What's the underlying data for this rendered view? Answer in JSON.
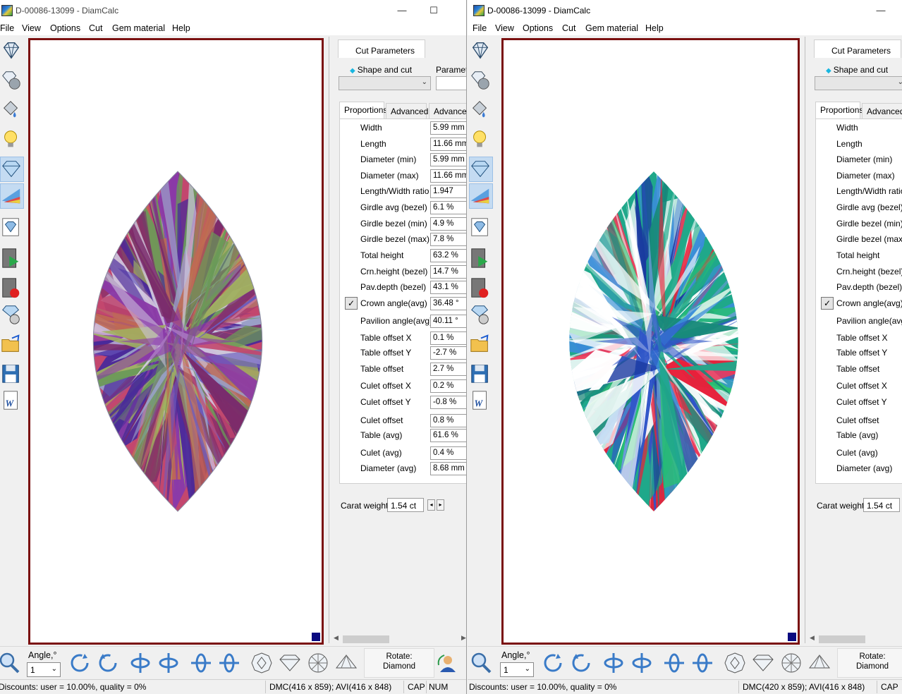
{
  "windows": [
    {
      "title": "D-00086-13099 - DiamCalc",
      "menu": [
        "File",
        "View",
        "Options",
        "Cut",
        "Gem material",
        "Help"
      ],
      "panel_tab": "Cut Parameters",
      "shape_label": "Shape and cut",
      "param_label": "Paramete",
      "inner_tabs": [
        "Proportions",
        "Advanced",
        "Advanced"
      ],
      "params": [
        {
          "label": "Width",
          "value": "5.99 mm"
        },
        {
          "label": "Length",
          "value": "11.66 mm"
        },
        {
          "label": "Diameter (min)",
          "value": "5.99 mm"
        },
        {
          "label": "Diameter (max)",
          "value": "11.66 mm"
        },
        {
          "label": "Length/Width ratio",
          "value": "1.947"
        },
        {
          "label": "Girdle avg (bezel)",
          "value": "6.1 %"
        },
        {
          "label": "Girdle bezel (min)",
          "value": "4.9 %"
        },
        {
          "label": "Girdle bezel (max)",
          "value": "7.8 %"
        },
        {
          "label": "Total height",
          "value": "63.2 %"
        },
        {
          "label": "Crn.height (bezel)",
          "value": "14.7 %"
        },
        {
          "label": "Pav.depth (bezel)",
          "value": "43.1 %"
        },
        {
          "label": "Crown angle(avg)",
          "value": "36.48 °"
        },
        {
          "label": "Pavilion angle(avg)",
          "value": "40.11 °"
        },
        {
          "label": "Table offset X",
          "value": "0.1 %"
        },
        {
          "label": "Table offset Y",
          "value": "-2.7 %"
        },
        {
          "label": "Table offset",
          "value": "2.7 %"
        },
        {
          "label": "Culet offset X",
          "value": "0.2 %"
        },
        {
          "label": "Culet offset Y",
          "value": "-0.8 %"
        },
        {
          "label": "Culet offset",
          "value": "0.8 %"
        },
        {
          "label": "Table (avg)",
          "value": "61.6 %"
        },
        {
          "label": "Culet (avg)",
          "value": "0.4 %"
        },
        {
          "label": "Diameter (avg)",
          "value": "8.68 mm"
        }
      ],
      "carat_label": "Carat weight",
      "carat_value": "1.54 ct",
      "angle_label": "Angle,°",
      "angle_value": "1",
      "rotate_label": "Rotate:",
      "rotate_value": "Diamond",
      "status_discounts": "Discounts: user = 10.00%, quality = 0%",
      "status_dims": "DMC(416 x 859); AVI(416 x 848)",
      "status_cap": "CAP",
      "status_num": "NUM",
      "render_palette": [
        "#c3476e",
        "#8a3aa8",
        "#6a5cc0",
        "#9aa0c8",
        "#c06a52",
        "#a0b060",
        "#6a9a58",
        "#d0c8e0",
        "#7a2a6a",
        "#4a2a9a"
      ]
    },
    {
      "title": "D-00086-13099 - DiamCalc",
      "menu": [
        "File",
        "View",
        "Options",
        "Cut",
        "Gem material",
        "Help"
      ],
      "panel_tab": "Cut Parameters",
      "shape_label": "Shape and cut",
      "inner_tabs": [
        "Proportions",
        "Advanced"
      ],
      "params": [
        {
          "label": "Width"
        },
        {
          "label": "Length"
        },
        {
          "label": "Diameter (min)"
        },
        {
          "label": "Diameter (max)"
        },
        {
          "label": "Length/Width ratio"
        },
        {
          "label": "Girdle avg (bezel)"
        },
        {
          "label": "Girdle bezel (min)"
        },
        {
          "label": "Girdle bezel (max)"
        },
        {
          "label": "Total height"
        },
        {
          "label": "Crn.height (bezel)"
        },
        {
          "label": "Pav.depth (bezel)"
        },
        {
          "label": "Crown angle(avg)"
        },
        {
          "label": "Pavilion angle(avg)"
        },
        {
          "label": "Table offset X"
        },
        {
          "label": "Table offset Y"
        },
        {
          "label": "Table offset"
        },
        {
          "label": "Culet offset X"
        },
        {
          "label": "Culet offset Y"
        },
        {
          "label": "Culet offset"
        },
        {
          "label": "Table (avg)"
        },
        {
          "label": "Culet (avg)"
        },
        {
          "label": "Diameter (avg)"
        }
      ],
      "carat_label": "Carat weight",
      "carat_value": "1.54 ct",
      "angle_label": "Angle,°",
      "angle_value": "1",
      "rotate_label": "Rotate:",
      "rotate_value": "Diamond",
      "status_discounts": "Discounts: user = 10.00%, quality = 0%",
      "status_dims": "DMC(420 x 859); AVI(416 x 848)",
      "status_cap": "CAP",
      "render_palette": [
        "#1fa88a",
        "#2f55c8",
        "#e8203a",
        "#28c070",
        "#3a8ed8",
        "#ffffff",
        "#6a9ad8",
        "#188a7a",
        "#1a3aa0",
        "#f03a5a"
      ]
    }
  ],
  "icons": {
    "side_tools": [
      "diamond-cut-icon",
      "gem-sphere-icon",
      "paint-bucket-icon",
      "light-bulb-icon",
      "diamond-render-icon",
      "spectrum-icon",
      "diamond-card-icon",
      "video-play-icon",
      "video-record-icon",
      "gem-wheel-icon",
      "open-folder-icon",
      "save-disk-icon",
      "word-export-icon"
    ],
    "bottom_tools": [
      "zoom-icon",
      "rotate-cw-icon",
      "rotate-ccw-icon",
      "flip-vertical-icon",
      "flip-vertical-back-icon",
      "tilt-left-icon",
      "tilt-back-icon",
      "top-view-icon",
      "side-view-icon",
      "bottom-view-icon",
      "pavilion-view-icon",
      "user-rotate-icon"
    ]
  }
}
